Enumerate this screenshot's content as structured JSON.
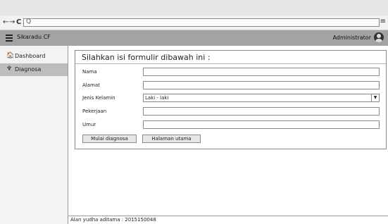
{
  "browser": {
    "back_icon": "arrow-left",
    "forward_icon": "arrow-right",
    "reload_icon": "reload",
    "back": "←",
    "forward": "→",
    "reload": "C",
    "search_glyph": "Q",
    "menu": "≡"
  },
  "app": {
    "title": "Sikaradu CF",
    "user": "Administrator",
    "hamburger_icon": "menu-icon"
  },
  "sidebar": {
    "items": [
      {
        "label": "Dashboard",
        "icon": "home-icon",
        "glyph": "🏠",
        "active": false
      },
      {
        "label": "Diagnosa",
        "icon": "stethoscope-icon",
        "glyph": "♆",
        "active": true
      }
    ]
  },
  "form": {
    "title": "Silahkan isi formulir dibawah ini :",
    "fields": [
      {
        "label": "Nama",
        "value": ""
      },
      {
        "label": "Alamat",
        "value": ""
      },
      {
        "label": "Jenis Kelamin",
        "value": "Laki - laki"
      },
      {
        "label": "Pekerjaan",
        "value": ""
      },
      {
        "label": "Umur",
        "value": ""
      }
    ],
    "buttons": {
      "start": "Mulai diagnosa",
      "home": "Halaman utama"
    }
  },
  "footer": {
    "text": "Alan yudha aditama : 2015150048"
  },
  "colors": {
    "header_bg": "#a3a3a3",
    "sidebar_active": "#bdbdbd"
  }
}
